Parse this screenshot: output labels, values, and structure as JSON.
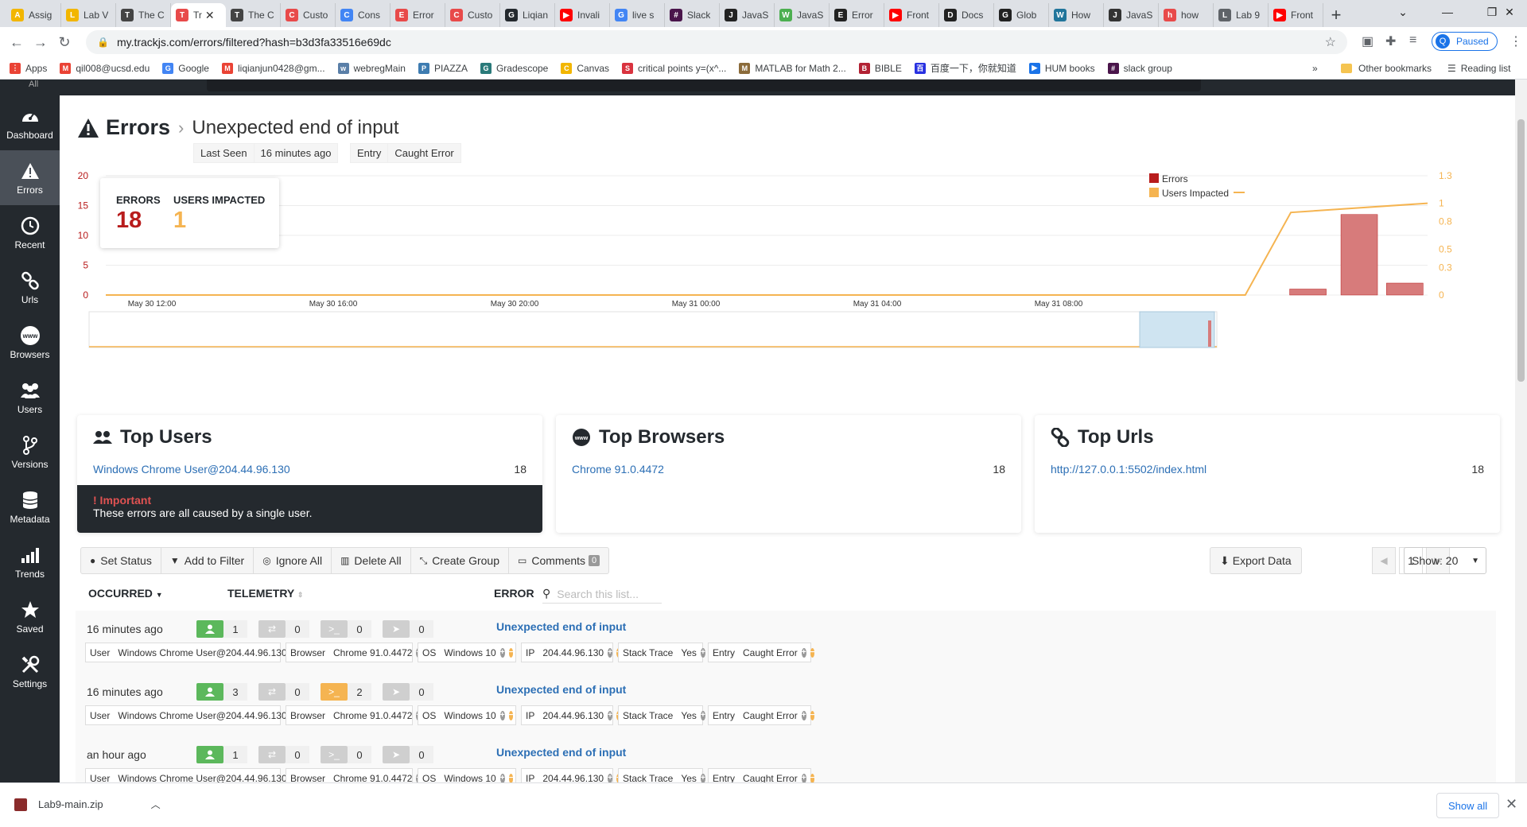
{
  "browser": {
    "tabs": [
      {
        "title": "Assig",
        "color": "#f2b600",
        "glyph": "A"
      },
      {
        "title": "Lab V",
        "color": "#f2b600",
        "glyph": "L"
      },
      {
        "title": "The C",
        "color": "#444444",
        "glyph": "T"
      },
      {
        "title": "Tr",
        "color": "#e84a4a",
        "glyph": "T",
        "active": true
      },
      {
        "title": "The C",
        "color": "#444444",
        "glyph": "T"
      },
      {
        "title": "Custo",
        "color": "#e84a4a",
        "glyph": "C"
      },
      {
        "title": "Cons",
        "color": "#4285f4",
        "glyph": "C"
      },
      {
        "title": "Error",
        "color": "#e84a4a",
        "glyph": "E"
      },
      {
        "title": "Custo",
        "color": "#e84a4a",
        "glyph": "C"
      },
      {
        "title": "Liqian",
        "color": "#24292e",
        "glyph": "G"
      },
      {
        "title": "Invali",
        "color": "#ff0000",
        "glyph": "▶"
      },
      {
        "title": "live s",
        "color": "#4285f4",
        "glyph": "G"
      },
      {
        "title": "Slack",
        "color": "#4a154b",
        "glyph": "#"
      },
      {
        "title": "JavaS",
        "color": "#222222",
        "glyph": "J"
      },
      {
        "title": "JavaS",
        "color": "#4caf50",
        "glyph": "W"
      },
      {
        "title": "Error",
        "color": "#222222",
        "glyph": "E"
      },
      {
        "title": "Front",
        "color": "#ff0000",
        "glyph": "▶"
      },
      {
        "title": "Docs",
        "color": "#222222",
        "glyph": "D"
      },
      {
        "title": "Glob",
        "color": "#222222",
        "glyph": "G"
      },
      {
        "title": "How",
        "color": "#21759b",
        "glyph": "W"
      },
      {
        "title": "JavaS",
        "color": "#333333",
        "glyph": "J"
      },
      {
        "title": "how",
        "color": "#e84a4a",
        "glyph": "h"
      },
      {
        "title": "Lab 9",
        "color": "#5f6368",
        "glyph": "L"
      },
      {
        "title": "Front",
        "color": "#ff0000",
        "glyph": "▶"
      }
    ],
    "url": "my.trackjs.com/errors/filtered?hash=b3d3fa33516e69dc",
    "profile_label": "Paused",
    "profile_initial": "Q",
    "bookmarks": [
      {
        "label": "Apps",
        "color": "#ea4335",
        "glyph": "⋮"
      },
      {
        "label": "qil008@ucsd.edu",
        "color": "#ea4335",
        "glyph": "M"
      },
      {
        "label": "Google",
        "color": "#4285f4",
        "glyph": "G"
      },
      {
        "label": "liqianjun0428@gm...",
        "color": "#ea4335",
        "glyph": "M"
      },
      {
        "label": "webregMain",
        "color": "#5a7fa8",
        "glyph": "w"
      },
      {
        "label": "PIAZZA",
        "color": "#3e7cb1",
        "glyph": "P"
      },
      {
        "label": "Gradescope",
        "color": "#2a7a7a",
        "glyph": "G"
      },
      {
        "label": "Canvas",
        "color": "#f2b600",
        "glyph": "C"
      },
      {
        "label": "critical points y=(x^...",
        "color": "#d9333f",
        "glyph": "S"
      },
      {
        "label": "MATLAB for Math 2...",
        "color": "#8b6b3a",
        "glyph": "M"
      },
      {
        "label": "BIBLE",
        "color": "#b22234",
        "glyph": "B"
      },
      {
        "label": "百度一下，你就知道",
        "color": "#2932e1",
        "glyph": "百"
      },
      {
        "label": "HUM books",
        "color": "#1a73e8",
        "glyph": "▶"
      },
      {
        "label": "slack group",
        "color": "#4a154b",
        "glyph": "#"
      }
    ],
    "bookmarks_more": "»",
    "other_bookmarks": "Other bookmarks",
    "reading_list": "Reading list"
  },
  "sidebar": {
    "top_label": "All",
    "items": [
      {
        "label": "Dashboard",
        "icon": "dashboard-icon"
      },
      {
        "label": "Errors",
        "icon": "warning-icon",
        "active": true
      },
      {
        "label": "Recent",
        "icon": "clock-icon"
      },
      {
        "label": "Urls",
        "icon": "link-icon"
      },
      {
        "label": "Browsers",
        "icon": "www-icon"
      },
      {
        "label": "Users",
        "icon": "users-icon"
      },
      {
        "label": "Versions",
        "icon": "branch-icon"
      },
      {
        "label": "Metadata",
        "icon": "database-icon"
      },
      {
        "label": "Trends",
        "icon": "bar-chart-icon"
      },
      {
        "label": "Saved",
        "icon": "star-icon"
      },
      {
        "label": "Settings",
        "icon": "tools-icon"
      }
    ]
  },
  "header": {
    "title": "Errors",
    "separator": "›",
    "subtitle": "Unexpected end of input",
    "last_seen_label": "Last Seen",
    "last_seen_value": "16 minutes ago",
    "entry_label": "Entry",
    "entry_value": "Caught Error"
  },
  "summary": {
    "errors_label": "ERRORS",
    "errors_value": "18",
    "users_label": "USERS IMPACTED",
    "users_value": "1"
  },
  "colors": {
    "errors": "#b81c1c",
    "errors_bar": "#d77b7b",
    "users": "#f5b451",
    "link": "#2c6fb5",
    "sidebar": "#24292e"
  },
  "chart_data": {
    "type": "bar",
    "x_ticks": [
      "May 30 12:00",
      "May 30 16:00",
      "May 30 20:00",
      "May 31 00:00",
      "May 31 04:00",
      "May 31 08:00"
    ],
    "x_range": [
      8.3,
      31.5
    ],
    "y_left_ticks": [
      "0",
      "5",
      "10",
      "15",
      "20"
    ],
    "y_left_range": [
      0,
      20
    ],
    "y_right_ticks": [
      "0",
      "0.3",
      "0.5",
      "0.8",
      "1",
      "1.3"
    ],
    "y_right_range": [
      0,
      1.3
    ],
    "series": [
      {
        "name": "Errors",
        "kind": "bar",
        "axis": "left",
        "x": [
          29.4,
          30.3,
          31.1
        ],
        "values": [
          1,
          13.5,
          2
        ]
      },
      {
        "name": "Users Impacted",
        "kind": "line",
        "axis": "right",
        "x": [
          8.3,
          28.3,
          29.1,
          31.5
        ],
        "values": [
          0,
          0,
          0.9,
          1
        ]
      }
    ],
    "legend_position": "top-right",
    "grid": true
  },
  "cards": {
    "users": {
      "title": "Top Users",
      "item": "Windows Chrome User@204.44.96.130",
      "count": "18",
      "important_label": "! Important",
      "important_text": "These errors are all caused by a single user."
    },
    "browsers": {
      "title": "Top Browsers",
      "item": "Chrome 91.0.4472",
      "count": "18"
    },
    "urls": {
      "title": "Top Urls",
      "item": "http://127.0.0.1:5502/index.html",
      "count": "18"
    }
  },
  "toolbar": {
    "set_status": "Set Status",
    "add_filter": "Add to Filter",
    "ignore_all": "Ignore All",
    "delete_all": "Delete All",
    "create_group": "Create Group",
    "comments": "Comments",
    "comments_count": "0",
    "export": "Export Data",
    "page": "1",
    "show": "Show: 20"
  },
  "list": {
    "col_occurred": "OCCURRED",
    "col_telemetry": "TELEMETRY",
    "col_error": "ERROR",
    "search_placeholder": "Search this list...",
    "rows": [
      {
        "occurred": "16 minutes ago",
        "users": "1",
        "network": "0",
        "console": "0",
        "nav": "0",
        "console_active": false,
        "error": "Unexpected end of input",
        "meta": [
          {
            "k": "User",
            "v": "Windows Chrome User@204.44.96.130",
            "minus": true
          },
          {
            "k": "Browser",
            "v": "Chrome 91.0.4472",
            "minus": true
          },
          {
            "k": "OS",
            "v": "Windows 10",
            "minus": true
          },
          {
            "k": "IP",
            "v": "204.44.96.130",
            "minus": true
          },
          {
            "k": "Stack Trace",
            "v": "Yes",
            "minus": false
          },
          {
            "k": "Entry",
            "v": "Caught Error",
            "minus": true
          }
        ]
      },
      {
        "occurred": "16 minutes ago",
        "users": "3",
        "network": "0",
        "console": "2",
        "nav": "0",
        "console_active": true,
        "error": "Unexpected end of input",
        "meta": [
          {
            "k": "User",
            "v": "Windows Chrome User@204.44.96.130",
            "minus": true
          },
          {
            "k": "Browser",
            "v": "Chrome 91.0.4472",
            "minus": true
          },
          {
            "k": "OS",
            "v": "Windows 10",
            "minus": true
          },
          {
            "k": "IP",
            "v": "204.44.96.130",
            "minus": true
          },
          {
            "k": "Stack Trace",
            "v": "Yes",
            "minus": false
          },
          {
            "k": "Entry",
            "v": "Caught Error",
            "minus": true
          }
        ]
      },
      {
        "occurred": "an hour ago",
        "users": "1",
        "network": "0",
        "console": "0",
        "nav": "0",
        "console_active": false,
        "error": "Unexpected end of input",
        "meta": [
          {
            "k": "User",
            "v": "Windows Chrome User@204.44.96.130",
            "minus": true
          },
          {
            "k": "Browser",
            "v": "Chrome 91.0.4472",
            "minus": true
          },
          {
            "k": "OS",
            "v": "Windows 10",
            "minus": true
          },
          {
            "k": "IP",
            "v": "204.44.96.130",
            "minus": true
          },
          {
            "k": "Stack Trace",
            "v": "Yes",
            "minus": false
          },
          {
            "k": "Entry",
            "v": "Caught Error",
            "minus": true
          }
        ]
      }
    ]
  },
  "downloads": {
    "file": "Lab9-main.zip",
    "show_all": "Show all"
  }
}
